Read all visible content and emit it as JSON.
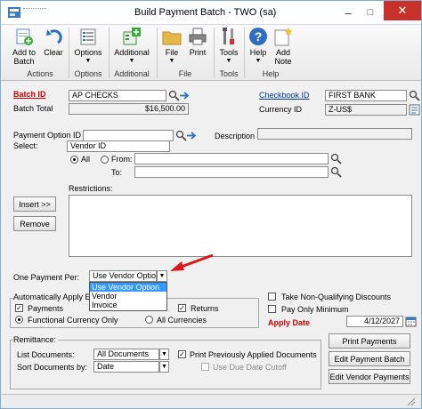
{
  "window": {
    "title": "Build Payment Batch  -  TWO (sa)"
  },
  "ribbon": {
    "add_to_batch": "Add to\nBatch",
    "clear": "Clear",
    "group_actions": "Actions",
    "options": "Options",
    "group_options": "Options",
    "additional": "Additional",
    "group_additional": "Additional",
    "file": "File",
    "print": "Print",
    "group_file": "File",
    "tools": "Tools",
    "group_tools": "Tools",
    "help": "Help",
    "add_note": "Add\nNote",
    "group_help": "Help"
  },
  "form": {
    "batch_id_label": "Batch ID",
    "batch_id_value": "AP CHECKS",
    "batch_total_label": "Batch Total",
    "batch_total_value": "$16,500.00",
    "checkbook_label": "Checkbook ID",
    "checkbook_value": "FIRST BANK",
    "currency_label": "Currency ID",
    "currency_value": "Z-US$",
    "payment_option_label": "Payment Option ID",
    "payment_option_value": "",
    "description_label": "Description",
    "select_label": "Select:",
    "select_value": "Vendor ID",
    "all_label": "All",
    "from_label": "From:",
    "to_label": "To:",
    "restrictions_label": "Restrictions:",
    "insert_button": "Insert >>",
    "remove_button": "Remove",
    "one_payment_label": "One Payment Per:",
    "one_payment_value": "Use Vendor Option",
    "dropdown_options": [
      "Use Vendor Option",
      "Vendor",
      "Invoice"
    ],
    "auto_apply_label": "Automatically Apply Exis",
    "payments_label": "Payments",
    "returns_label": "Returns",
    "functional_currency_label": "Functional Currency Only",
    "all_currencies_label": "All Currencies",
    "take_nonqual_label": "Take Non-Qualifying Discounts",
    "pay_only_min_label": "Pay Only Minimum",
    "apply_date_label": "Apply Date",
    "apply_date_value": "4/12/2027",
    "remittance_label": "Remittance:",
    "list_documents_label": "List Documents:",
    "list_documents_value": "All Documents",
    "sort_documents_label": "Sort Documents by:",
    "sort_documents_value": "Date",
    "print_prev_label": "Print Previously Applied Documents",
    "use_due_date_label": "Use Due Date Cutoff",
    "print_payments_button": "Print Payments",
    "edit_batch_button": "Edit Payment Batch",
    "edit_vendor_button": "Edit Vendor Payments"
  },
  "colors": {
    "accent_red": "#d00000",
    "selection_blue": "#3399ff",
    "link_blue": "#0033aa"
  }
}
